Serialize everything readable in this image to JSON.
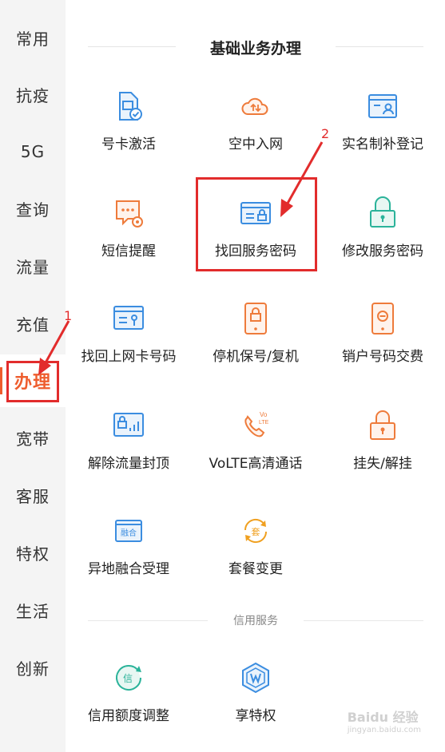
{
  "sidebar": {
    "items": [
      {
        "label": "常用"
      },
      {
        "label": "抗疫"
      },
      {
        "label": "5G"
      },
      {
        "label": "查询"
      },
      {
        "label": "流量"
      },
      {
        "label": "充值"
      },
      {
        "label": "办理"
      },
      {
        "label": "宽带"
      },
      {
        "label": "客服"
      },
      {
        "label": "特权"
      },
      {
        "label": "生活"
      },
      {
        "label": "创新"
      }
    ],
    "active": "办理"
  },
  "section_basic": {
    "title": "基础业务办理",
    "items": [
      {
        "label": "号卡激活",
        "icon": "sim-card-check-icon"
      },
      {
        "label": "空中入网",
        "icon": "cloud-upload-icon"
      },
      {
        "label": "实名制补登记",
        "icon": "id-card-icon"
      },
      {
        "label": "短信提醒",
        "icon": "sms-gear-icon"
      },
      {
        "label": "找回服务密码",
        "icon": "card-lock-icon"
      },
      {
        "label": "修改服务密码",
        "icon": "padlock-icon"
      },
      {
        "label": "找回上网卡号码",
        "icon": "card-key-icon"
      },
      {
        "label": "停机保号/复机",
        "icon": "phone-lock-icon"
      },
      {
        "label": "销户号码交费",
        "icon": "phone-minus-icon"
      },
      {
        "label": "解除流量封顶",
        "icon": "data-signal-icon"
      },
      {
        "label": "VoLTE高清通话",
        "icon": "volte-phone-icon"
      },
      {
        "label": "挂失/解挂",
        "icon": "lock-report-icon"
      },
      {
        "label": "异地融合受理",
        "icon": "merge-card-icon"
      },
      {
        "label": "套餐变更",
        "icon": "package-change-icon"
      }
    ]
  },
  "section_credit": {
    "title": "信用服务",
    "items": [
      {
        "label": "信用额度调整",
        "icon": "credit-circle-icon"
      },
      {
        "label": "享特权",
        "icon": "privilege-hex-icon"
      }
    ]
  },
  "annotations": {
    "step1": "1",
    "step2": "2"
  },
  "watermark": {
    "text": "Baidu 经验",
    "sub": "jingyan.baidu.com"
  },
  "colors": {
    "orange": "#ee7b3b",
    "blue": "#3b8de0",
    "teal": "#2bb39a",
    "annotation_red": "#e22c2c"
  }
}
